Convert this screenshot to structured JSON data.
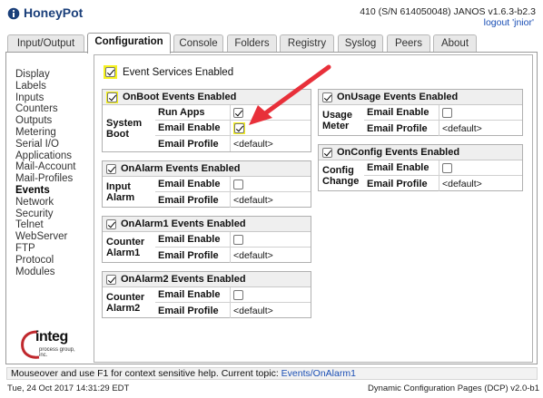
{
  "header": {
    "app_title": "HoneyPot",
    "device_info": "410 (S/N 614050048) JANOS v1.6.3-b2.3",
    "logout_label": "logout 'jnior'"
  },
  "tabs": [
    {
      "label": "Input/Output"
    },
    {
      "label": "Configuration"
    },
    {
      "label": "Console"
    },
    {
      "label": "Folders"
    },
    {
      "label": "Registry"
    },
    {
      "label": "Syslog"
    },
    {
      "label": "Peers"
    },
    {
      "label": "About"
    }
  ],
  "active_tab": "Configuration",
  "sidebar": {
    "items": [
      {
        "label": "Display"
      },
      {
        "label": "Labels"
      },
      {
        "label": "Inputs"
      },
      {
        "label": "Counters"
      },
      {
        "label": "Outputs"
      },
      {
        "label": "Metering"
      },
      {
        "label": "Serial I/O"
      },
      {
        "label": "Applications"
      },
      {
        "label": "Mail-Account"
      },
      {
        "label": "Mail-Profiles"
      },
      {
        "label": "Events"
      },
      {
        "label": "Network"
      },
      {
        "label": "Security"
      },
      {
        "label": "Telnet"
      },
      {
        "label": "WebServer"
      },
      {
        "label": "FTP"
      },
      {
        "label": "Protocol"
      },
      {
        "label": "Modules"
      }
    ],
    "active": "Events"
  },
  "master": {
    "label": "Event Services Enabled",
    "checked": true
  },
  "groups": {
    "onboot": {
      "title": "OnBoot Events Enabled",
      "checked": true,
      "row_label": "System Boot",
      "fields": [
        {
          "name": "Run Apps",
          "type": "checkbox",
          "checked": true
        },
        {
          "name": "Email Enable",
          "type": "checkbox",
          "checked": true
        },
        {
          "name": "Email Profile",
          "type": "text",
          "value": "<default>"
        }
      ]
    },
    "onalarm": {
      "title": "OnAlarm Events Enabled",
      "checked": true,
      "row_label": "Input Alarm",
      "fields": [
        {
          "name": "Email Enable",
          "type": "checkbox",
          "checked": false
        },
        {
          "name": "Email Profile",
          "type": "text",
          "value": "<default>"
        }
      ]
    },
    "onalarm1": {
      "title": "OnAlarm1 Events Enabled",
      "checked": true,
      "row_label": "Counter Alarm1",
      "fields": [
        {
          "name": "Email Enable",
          "type": "checkbox",
          "checked": false
        },
        {
          "name": "Email Profile",
          "type": "text",
          "value": "<default>"
        }
      ]
    },
    "onalarm2": {
      "title": "OnAlarm2 Events Enabled",
      "checked": true,
      "row_label": "Counter Alarm2",
      "fields": [
        {
          "name": "Email Enable",
          "type": "checkbox",
          "checked": false
        },
        {
          "name": "Email Profile",
          "type": "text",
          "value": "<default>"
        }
      ]
    },
    "onusage": {
      "title": "OnUsage Events Enabled",
      "checked": true,
      "row_label": "Usage Meter",
      "fields": [
        {
          "name": "Email Enable",
          "type": "checkbox",
          "checked": false
        },
        {
          "name": "Email Profile",
          "type": "text",
          "value": "<default>"
        }
      ]
    },
    "onconfig": {
      "title": "OnConfig Events Enabled",
      "checked": true,
      "row_label": "Config Change",
      "fields": [
        {
          "name": "Email Enable",
          "type": "checkbox",
          "checked": false
        },
        {
          "name": "Email Profile",
          "type": "text",
          "value": "<default>"
        }
      ]
    }
  },
  "logo": {
    "text": "integ",
    "sub": "process group, inc."
  },
  "help": {
    "prefix": "Mouseover and use F1 for context sensitive help. Current topic:",
    "topic": "Events/OnAlarm1"
  },
  "status": {
    "left": "Tue, 24 Oct 2017 14:31:29 EDT",
    "right": "Dynamic Configuration Pages (DCP) v2.0-b1"
  },
  "colors": {
    "title_blue": "#1a3f7a",
    "link_blue": "#1a4fb5",
    "highlight": "#f6f21f",
    "annotation_arrow": "#e8303a"
  }
}
